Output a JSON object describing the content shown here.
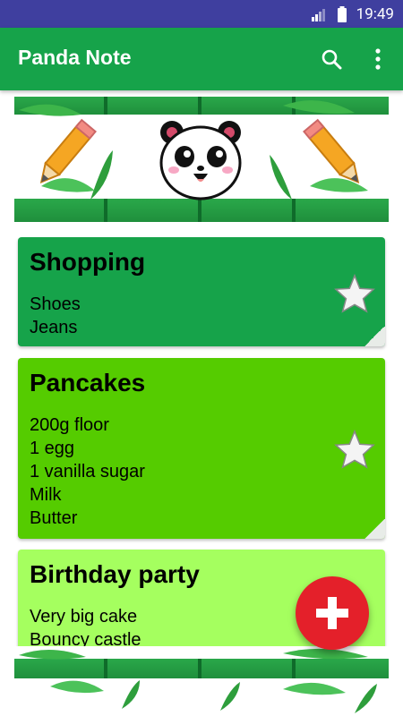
{
  "status_bar": {
    "time": "19:49"
  },
  "app_bar": {
    "title": "Panda Note",
    "search_icon": "search-icon",
    "menu_icon": "more-vert-icon"
  },
  "notes": [
    {
      "title": "Shopping",
      "lines": [
        "Shoes",
        "Jeans"
      ],
      "color": "#16a34a",
      "starred": false
    },
    {
      "title": "Pancakes",
      "lines": [
        "200g floor",
        "1 egg",
        "1 vanilla sugar",
        "Milk",
        "Butter"
      ],
      "color": "#55cc00",
      "starred": false
    },
    {
      "title": "Birthday party",
      "lines": [
        "Very big cake",
        "Bouncy castle"
      ],
      "color": "#a5ff5f",
      "starred": false
    }
  ],
  "fab": {
    "icon": "plus-icon",
    "color": "#e4202a"
  }
}
